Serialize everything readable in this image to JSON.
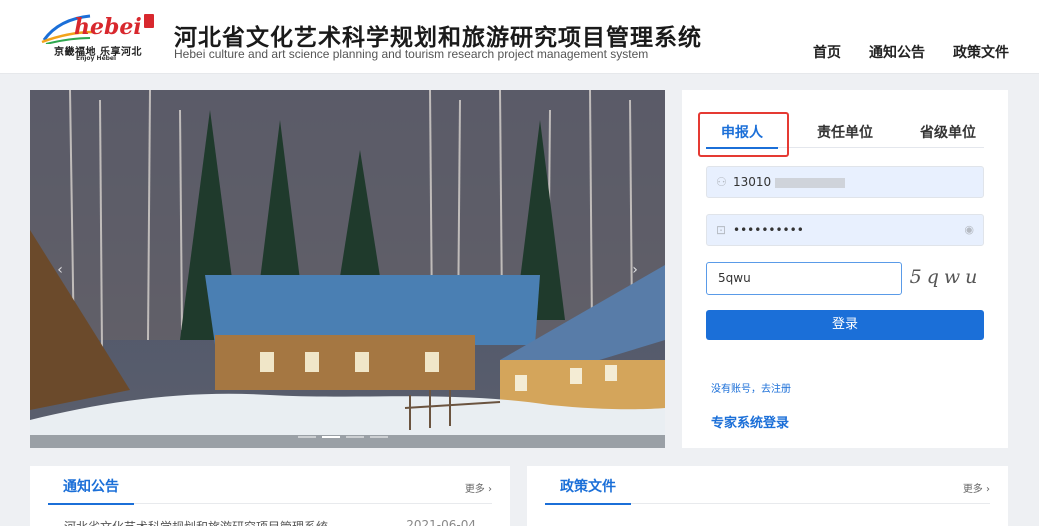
{
  "header": {
    "logo_word": "hebei",
    "logo_tagline": "京畿福地 乐享河北",
    "logo_subline": "Enjoy Hebei",
    "title": "河北省文化艺术科学规划和旅游研究项目管理系统",
    "subtitle": "Hebei culture and art science planning and tourism research project management system",
    "nav": [
      "首页",
      "通知公告",
      "政策文件"
    ]
  },
  "banner": {
    "slides": 4,
    "active_slide": 2
  },
  "login": {
    "tabs": [
      "申报人",
      "责任单位",
      "省级单位"
    ],
    "active_tab": 0,
    "username_value": "13010",
    "password_value": "••••••••••",
    "captcha_input_value": "5qwu",
    "captcha_image_text": "5qwu",
    "submit_label": "登录",
    "register_link": "没有账号，去注册",
    "expert_link": "专家系统登录"
  },
  "panels": {
    "notice": {
      "title": "通知公告",
      "more": "更多 ›",
      "items": [
        {
          "text": "河北省文化艺术科学规划和旅游研究项目管理系统",
          "date": "2021-06-04"
        }
      ]
    },
    "policy": {
      "title": "政策文件",
      "more": "更多 ›"
    }
  },
  "colors": {
    "primary": "#1b6fd8",
    "highlight": "#e53a33",
    "field_bg": "#e8f0fe"
  }
}
